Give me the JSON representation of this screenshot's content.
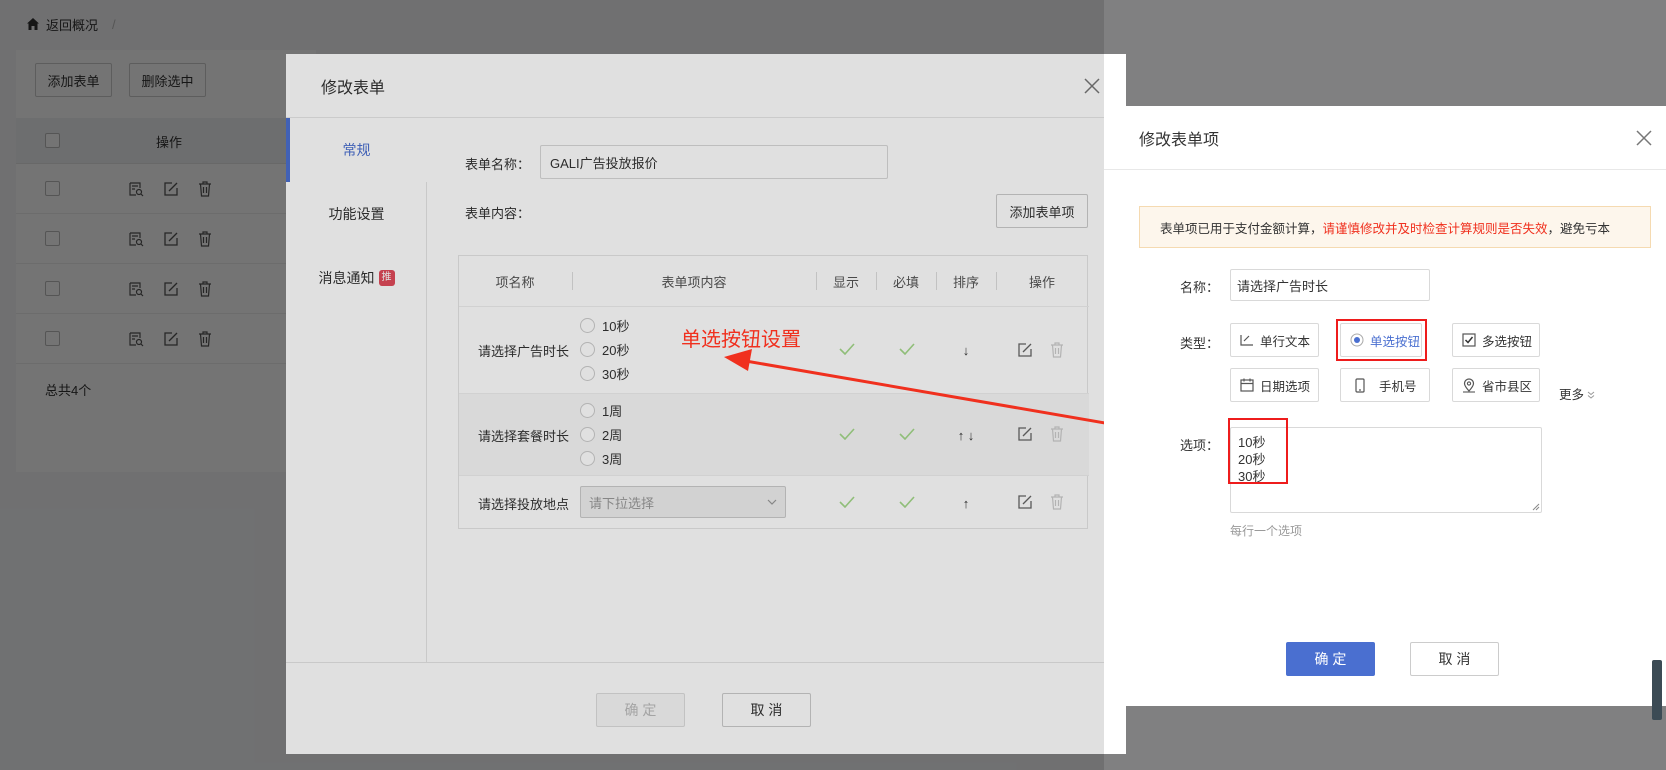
{
  "background": {
    "breadcrumb": {
      "back_label": "返回概况",
      "separator": "/"
    },
    "toolbar": {
      "add_label": "添加表单",
      "delete_label": "删除选中"
    },
    "list": {
      "header_ops": "操作",
      "total_text": "总共4个",
      "row_count": 4
    }
  },
  "form_modal": {
    "title": "修改表单",
    "sidebar": [
      {
        "label": "常规",
        "active": true
      },
      {
        "label": "功能设置",
        "active": false
      },
      {
        "label": "消息通知",
        "active": false,
        "badge": "推"
      }
    ],
    "name_label": "表单名称：",
    "name_value": "GALI广告投放报价",
    "content_label": "表单内容：",
    "add_item_label": "添加表单项",
    "table": {
      "headers": [
        "项名称",
        "表单项内容",
        "显示",
        "必填",
        "排序",
        "操作"
      ],
      "rows": [
        {
          "name": "请选择广告时长",
          "options": [
            "10秒",
            "20秒",
            "30秒"
          ],
          "sort": "↓"
        },
        {
          "name": "请选择套餐时长",
          "options": [
            "1周",
            "2周",
            "3周"
          ],
          "sort": "↑ ↓"
        },
        {
          "name": "请选择投放地点",
          "select_placeholder": "请下拉选择",
          "sort": "↑"
        }
      ]
    },
    "confirm_label": "确 定",
    "cancel_label": "取 消"
  },
  "annotation": {
    "text": "单选按钮设置",
    "color": "#f0301e"
  },
  "item_modal": {
    "title": "修改表单项",
    "warning": {
      "prefix": "表单项已用于支付金额计算，",
      "emphasis": "请谨慎修改并及时检查计算规则是否失效",
      "suffix": "，避免亏本"
    },
    "name_label": "名称：",
    "name_value": "请选择广告时长",
    "type_label": "类型：",
    "types": [
      {
        "label": "单行文本",
        "icon": "edit-text-icon"
      },
      {
        "label": "单选按钮",
        "icon": "radio-icon",
        "selected": true
      },
      {
        "label": "多选按钮",
        "icon": "checkbox-icon"
      },
      {
        "label": "日期选项",
        "icon": "calendar-icon"
      },
      {
        "label": "手机号",
        "icon": "phone-icon"
      },
      {
        "label": "省市县区",
        "icon": "location-icon"
      }
    ],
    "more_label": "更多",
    "options_label": "选项：",
    "options_value": "10秒\n20秒\n30秒",
    "options_hint": "每行一个选项",
    "confirm_label": "确 定",
    "cancel_label": "取 消"
  },
  "colors": {
    "primary": "#4a6fd0",
    "annotation_red": "#f0301e",
    "check_green": "#52c41a"
  }
}
